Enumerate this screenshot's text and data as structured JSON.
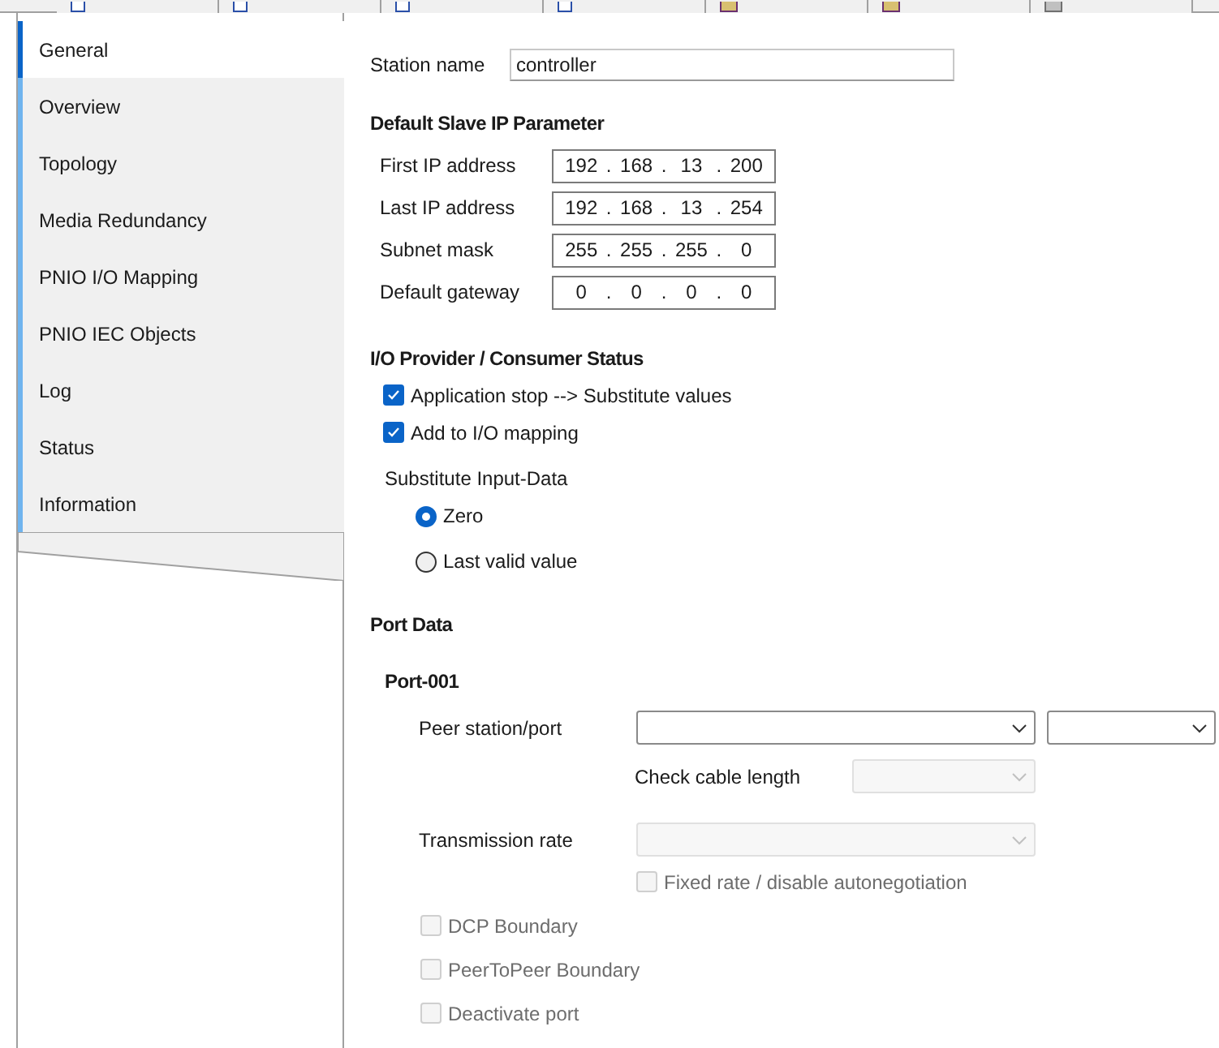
{
  "document_tabs": [
    {
      "kind": "document"
    },
    {
      "kind": "document"
    },
    {
      "kind": "document"
    },
    {
      "kind": "document"
    },
    {
      "kind": "module"
    },
    {
      "kind": "module"
    },
    {
      "kind": "link"
    }
  ],
  "navigation": [
    {
      "label": "General",
      "selected": true
    },
    {
      "label": "Overview",
      "selected": false
    },
    {
      "label": "Topology",
      "selected": false
    },
    {
      "label": "Media Redundancy",
      "selected": false
    },
    {
      "label": "PNIO I/O Mapping",
      "selected": false
    },
    {
      "label": "PNIO IEC Objects",
      "selected": false
    },
    {
      "label": "Log",
      "selected": false
    },
    {
      "label": "Status",
      "selected": false
    },
    {
      "label": "Information",
      "selected": false
    }
  ],
  "station_name": {
    "label": "Station name",
    "value": "controller"
  },
  "ip_parameter": {
    "title": "Default Slave IP Parameter",
    "rows": [
      {
        "label": "First IP address",
        "octets": [
          "192",
          "168",
          "13",
          "200"
        ],
        "separators": [
          ".",
          ".",
          "."
        ]
      },
      {
        "label": "Last IP address",
        "octets": [
          "192",
          "168",
          "13",
          "254"
        ],
        "separators": [
          ".",
          ".",
          "."
        ]
      },
      {
        "label": "Subnet mask",
        "octets": [
          "255",
          "255",
          "255",
          "0"
        ],
        "separators": [
          ".",
          ".",
          "."
        ]
      },
      {
        "label": "Default gateway",
        "octets": [
          "0",
          "0",
          "0",
          "0"
        ],
        "separators": [
          ".",
          ".",
          "."
        ]
      }
    ]
  },
  "io_status": {
    "title": "I/O Provider / Consumer Status",
    "options": [
      {
        "label": "Application stop --> Substitute values",
        "checked": true
      },
      {
        "label": "Add to I/O mapping",
        "checked": true
      }
    ],
    "substitute_title": "Substitute Input-Data",
    "substitute": [
      {
        "label": "Zero",
        "selected": true
      },
      {
        "label": "Last valid value",
        "selected": false
      }
    ]
  },
  "port_data": {
    "title": "Port Data",
    "port": "Port-001",
    "peer_label": "Peer station/port",
    "cable_label": "Check cable length",
    "rate_label": "Transmission rate",
    "fixed_rate": {
      "label": "Fixed rate / disable autonegotiation",
      "checked": false,
      "disabled": true
    },
    "options": [
      {
        "label": "DCP Boundary",
        "checked": false,
        "disabled": true
      },
      {
        "label": "PeerToPeer Boundary",
        "checked": false,
        "disabled": true
      },
      {
        "label": "Deactivate port",
        "checked": false,
        "disabled": true
      }
    ]
  }
}
